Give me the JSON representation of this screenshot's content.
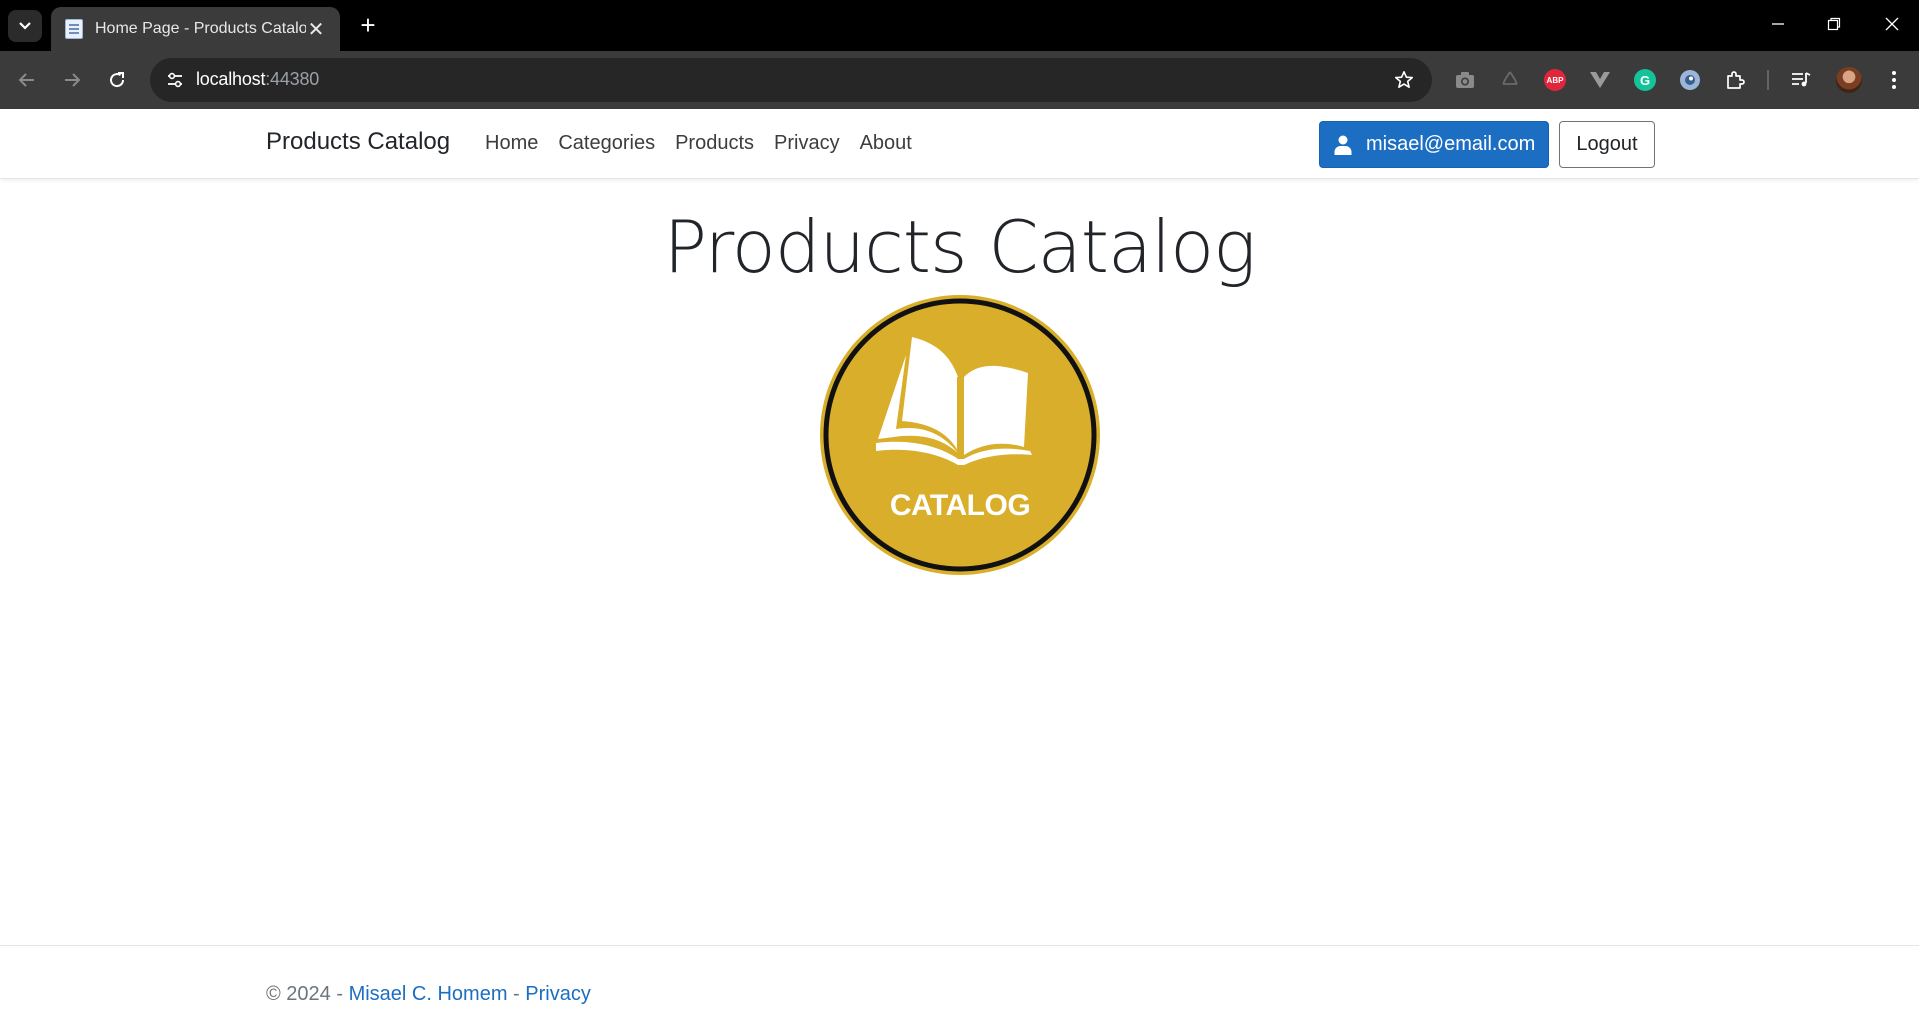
{
  "browser": {
    "tab_title": "Home Page - Products Catalog",
    "url_host": "localhost",
    "url_port": ":44380",
    "icons": [
      "tab-search-icon",
      "close-icon",
      "plus-icon",
      "back-icon",
      "forward-icon",
      "reload-icon",
      "site-info-icon",
      "star-icon",
      "camera-icon",
      "recycle-icon",
      "adblock-icon",
      "vivaldi-icon",
      "grammarly-icon",
      "extension-icon",
      "puzzle-icon",
      "media-icon",
      "avatar",
      "menu-icon"
    ],
    "adblock_label": "ABP",
    "grammarly_label": "G"
  },
  "navbar": {
    "brand": "Products Catalog",
    "links": [
      "Home",
      "Categories",
      "Products",
      "Privacy",
      "About"
    ],
    "user_email": "misael@email.com",
    "logout_label": "Logout",
    "user_button_color": "#1b6ec2"
  },
  "main": {
    "title": "Products Catalog",
    "logo_text": "CATALOG",
    "logo_color": "#d9ae2a"
  },
  "footer": {
    "prefix": "© 2024 - ",
    "author": "Misael C. Homem",
    "separator": " - ",
    "privacy": "Privacy"
  }
}
